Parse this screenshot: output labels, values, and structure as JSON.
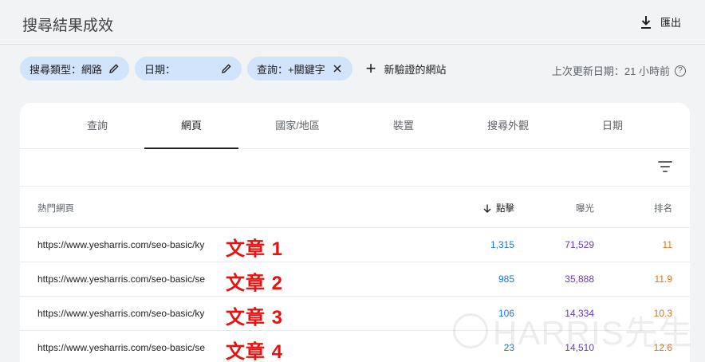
{
  "header": {
    "title": "搜尋結果成效",
    "export_label": "匯出"
  },
  "filters": {
    "chips": [
      {
        "label": "搜尋類型：網路"
      },
      {
        "label": "日期："
      },
      {
        "label": "查詢：+關鍵字"
      }
    ],
    "add_property_label": "新驗證的網站",
    "updated_text": "上次更新日期：21 小時前"
  },
  "tabs": [
    {
      "label": "查詢"
    },
    {
      "label": "網頁"
    },
    {
      "label": "國家/地區"
    },
    {
      "label": "裝置"
    },
    {
      "label": "搜尋外觀"
    },
    {
      "label": "日期"
    }
  ],
  "active_tab": "網頁",
  "table": {
    "columns": {
      "page": "熱門網頁",
      "clicks": "點擊",
      "impressions": "曝光",
      "position": "排名"
    },
    "rows": [
      {
        "url": "https://www.yesharris.com/seo-basic/ky",
        "annotation": "文章 1",
        "clicks": "1,315",
        "impressions": "71,529",
        "position": "11"
      },
      {
        "url": "https://www.yesharris.com/seo-basic/se",
        "annotation": "文章 2",
        "clicks": "985",
        "impressions": "35,888",
        "position": "11.9"
      },
      {
        "url": "https://www.yesharris.com/seo-basic/ky",
        "annotation": "文章 3",
        "clicks": "106",
        "impressions": "14,334",
        "position": "10.3"
      },
      {
        "url": "https://www.yesharris.com/seo-basic/se",
        "annotation": "文章 4",
        "clicks": "23",
        "impressions": "14,510",
        "position": "12.6"
      }
    ]
  },
  "colors": {
    "clicks": "#1a73e8",
    "impressions": "#673ab7",
    "position": "#e8710a",
    "annotation": "#e8110f",
    "chip_bg": "#d2e3fc"
  },
  "watermark": {
    "text": "HARRIS先生"
  }
}
